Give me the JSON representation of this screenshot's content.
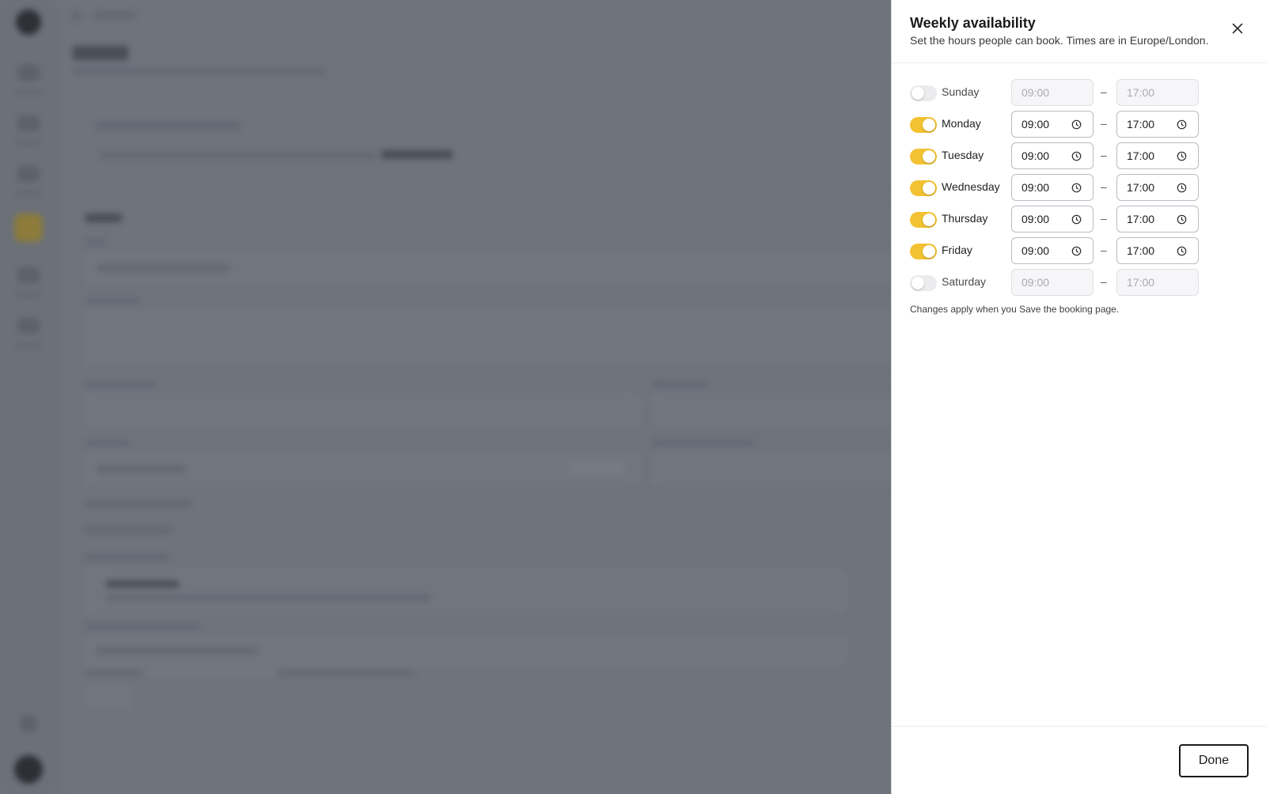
{
  "drawer": {
    "title": "Weekly availability",
    "subtitle": "Set the hours people can book. Times are in Europe/London.",
    "note": "Changes apply when you Save the booking page.",
    "done_label": "Done",
    "close_icon": "close-icon"
  },
  "days": [
    {
      "name": "Sunday",
      "enabled": false,
      "start": "09:00",
      "end": "17:00"
    },
    {
      "name": "Monday",
      "enabled": true,
      "start": "09:00",
      "end": "17:00"
    },
    {
      "name": "Tuesday",
      "enabled": true,
      "start": "09:00",
      "end": "17:00"
    },
    {
      "name": "Wednesday",
      "enabled": true,
      "start": "09:00",
      "end": "17:00"
    },
    {
      "name": "Thursday",
      "enabled": true,
      "start": "09:00",
      "end": "17:00"
    },
    {
      "name": "Friday",
      "enabled": true,
      "start": "09:00",
      "end": "17:00"
    },
    {
      "name": "Saturday",
      "enabled": false,
      "start": "09:00",
      "end": "17:00"
    }
  ],
  "separator": "–",
  "colors": {
    "toggle_on": "#f2c232",
    "overlay": "#6e737c"
  }
}
